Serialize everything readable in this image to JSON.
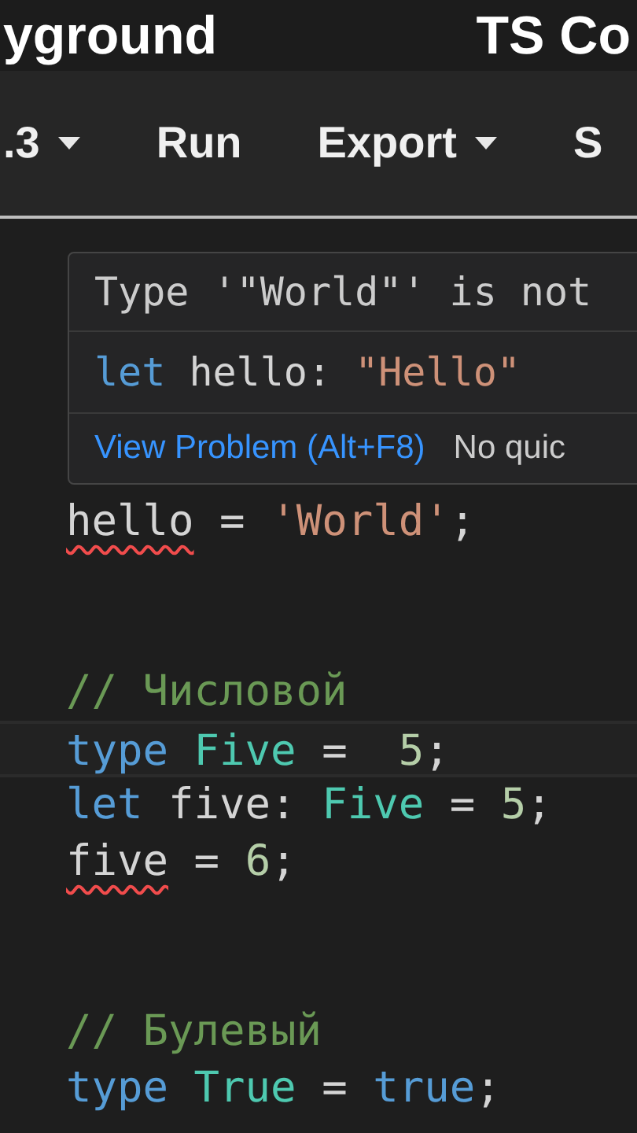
{
  "header": {
    "title": "yground",
    "right_text": "TS Co"
  },
  "toolbar": {
    "items": [
      {
        "label": ".3",
        "dropdown": true
      },
      {
        "label": "Run",
        "dropdown": false
      },
      {
        "label": "Export",
        "dropdown": true
      },
      {
        "label": "S",
        "dropdown": false
      }
    ]
  },
  "hover_popup": {
    "message": "Type '\"World\"' is not",
    "signature": [
      {
        "text": "let",
        "kind": "keyword"
      },
      {
        "text": " hello: ",
        "kind": "plain"
      },
      {
        "text": "\"Hello\"",
        "kind": "string"
      }
    ],
    "link": "View Problem (Alt+F8)",
    "note": "No quic"
  },
  "editor": {
    "lines": [
      {
        "current": false,
        "tokens": [
          {
            "text": "hello",
            "kind": "plain",
            "error": true
          },
          {
            "text": " = ",
            "kind": "plain",
            "error": false
          },
          {
            "text": "'World'",
            "kind": "string",
            "error": false
          },
          {
            "text": ";",
            "kind": "plain",
            "error": false
          }
        ]
      },
      {
        "current": false
      },
      {
        "current": false
      },
      {
        "current": false,
        "tokens": [
          {
            "text": "// Числовой",
            "kind": "comment",
            "error": false
          }
        ]
      },
      {
        "current": true,
        "tokens": [
          {
            "text": "type",
            "kind": "keyword",
            "error": false
          },
          {
            "text": " Five",
            "kind": "type",
            "error": false
          },
          {
            "text": " =  ",
            "kind": "plain",
            "error": false
          },
          {
            "text": "5",
            "kind": "number",
            "error": false
          },
          {
            "text": ";",
            "kind": "plain",
            "error": false
          }
        ]
      },
      {
        "current": false,
        "tokens": [
          {
            "text": "let",
            "kind": "keyword",
            "error": false
          },
          {
            "text": " five: ",
            "kind": "plain",
            "error": false
          },
          {
            "text": "Five",
            "kind": "type",
            "error": false
          },
          {
            "text": " = ",
            "kind": "plain",
            "error": false
          },
          {
            "text": "5",
            "kind": "number",
            "error": false
          },
          {
            "text": ";",
            "kind": "plain",
            "error": false
          }
        ]
      },
      {
        "current": false,
        "tokens": [
          {
            "text": "five",
            "kind": "plain",
            "error": true
          },
          {
            "text": " = ",
            "kind": "plain",
            "error": false
          },
          {
            "text": "6",
            "kind": "number",
            "error": false
          },
          {
            "text": ";",
            "kind": "plain",
            "error": false
          }
        ]
      },
      {
        "current": false
      },
      {
        "current": false
      },
      {
        "current": false,
        "tokens": [
          {
            "text": "// Булевый",
            "kind": "comment",
            "error": false
          }
        ]
      },
      {
        "current": false,
        "tokens": [
          {
            "text": "type",
            "kind": "keyword",
            "error": false
          },
          {
            "text": " True",
            "kind": "type",
            "error": false
          },
          {
            "text": " = ",
            "kind": "plain",
            "error": false
          },
          {
            "text": "true",
            "kind": "keyword",
            "error": false
          },
          {
            "text": ";",
            "kind": "plain",
            "error": false
          }
        ]
      }
    ]
  }
}
